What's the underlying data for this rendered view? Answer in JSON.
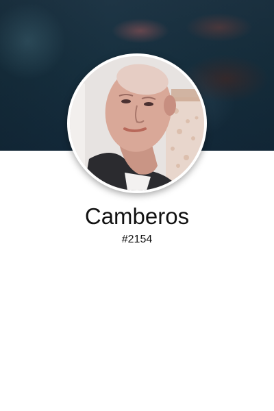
{
  "profile": {
    "display_name": "Camberos",
    "tag": "#2154",
    "avatar_icon": "user-photo",
    "cover_icon": "blurred-cover-photo"
  },
  "colors": {
    "cover_base": "#17303f",
    "ring": "#ffffff",
    "text": "#111111",
    "background": "#ffffff"
  }
}
